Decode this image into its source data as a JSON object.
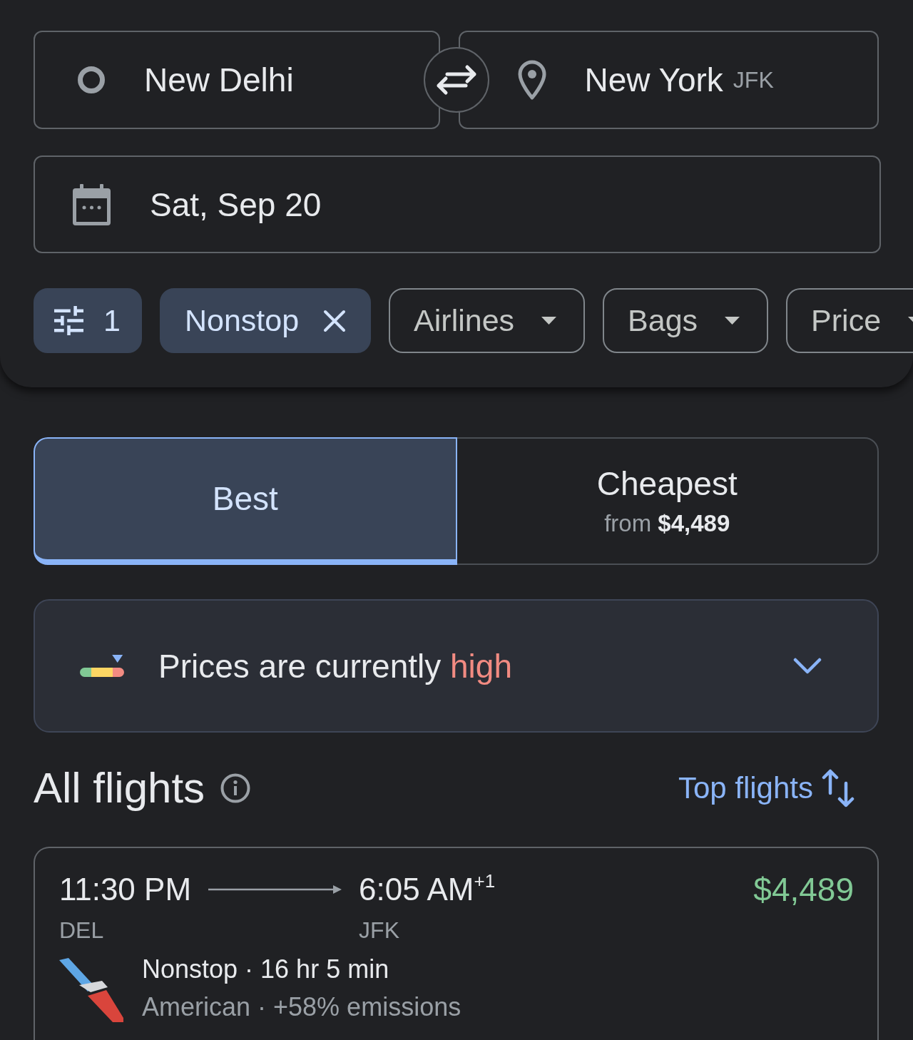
{
  "route": {
    "origin": {
      "city": "New Delhi"
    },
    "destination": {
      "city": "New York",
      "code": "JFK"
    }
  },
  "date": {
    "value": "Sat, Sep 20"
  },
  "filters": [
    {
      "kind": "all_filters",
      "label": "1",
      "active": true
    },
    {
      "kind": "removable",
      "label": "Nonstop",
      "active": true
    },
    {
      "kind": "dropdown",
      "label": "Airlines",
      "active": false
    },
    {
      "kind": "dropdown",
      "label": "Bags",
      "active": false
    },
    {
      "kind": "dropdown",
      "label": "Price",
      "active": false
    }
  ],
  "sort_tabs": [
    {
      "label": "Best",
      "selected": true
    },
    {
      "label": "Cheapest",
      "subtitle": "from **$4,489**",
      "selected": false
    }
  ],
  "price_insight": {
    "text": "Prices are currently",
    "highlight": "high",
    "level": 0.85,
    "expanded": false
  },
  "results": {
    "title": "All flights",
    "sort_link": "Top flights"
  },
  "flights": [
    {
      "depart_time": "11:30 PM",
      "arrive_time": "6:05 AM$^{+1}$",
      "depart_airport": "DEL",
      "arrive_airport": "JFK",
      "price": "$4,489",
      "summary": "Nonstop · 16 hr 5 min",
      "details": "American · +58% emissions"
    }
  ]
}
